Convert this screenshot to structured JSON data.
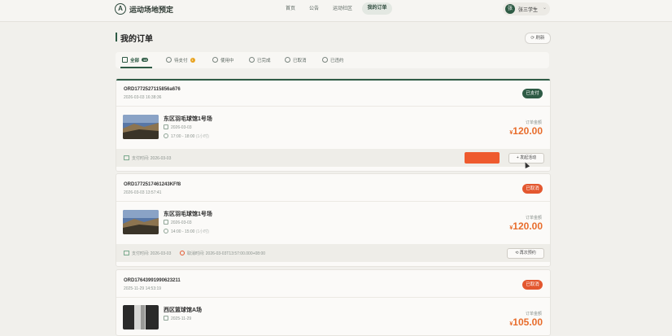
{
  "app": {
    "brand": "运动场地预定",
    "logo_letter": "A"
  },
  "nav": {
    "items": [
      "首页",
      "公告",
      "运动社区",
      "我的订单"
    ],
    "active": "我的订单"
  },
  "user": {
    "avatar_letter": "张",
    "name": "张三学生",
    "caret": "⌄"
  },
  "page": {
    "title": "我的订单",
    "refresh_label": "⟳ 刷新"
  },
  "tabs": [
    {
      "label": "全部",
      "badge": "13"
    },
    {
      "label": "待支付",
      "badge": "1"
    },
    {
      "label": "使用中"
    },
    {
      "label": "已完成"
    },
    {
      "label": "已取消"
    },
    {
      "label": "已违约"
    }
  ],
  "orders": [
    {
      "order_no": "ORD1772527115856a676",
      "created": "2026-03-03 16:38:36",
      "status": "已支付",
      "venue": "东区羽毛球馆1号场",
      "date": "2026-03-03",
      "time": "17:00 - 18:00",
      "duration": "(1小时)",
      "amount_label": "订单金额",
      "currency": "¥",
      "amount": "120.00",
      "pay_time": "支付时间: 2026-03-03",
      "action_label": "+ 发起活动"
    },
    {
      "order_no": "ORD1772517461243KFf8",
      "created": "2026-03-03 13:57:41",
      "status": "已取消",
      "venue": "东区羽毛球馆1号场",
      "date": "2026-03-03",
      "time": "14:00 - 15:00",
      "duration": "(1小时)",
      "amount_label": "订单金额",
      "currency": "¥",
      "amount": "120.00",
      "pay_time": "支付时间: 2026-03-03",
      "cancel_time": "取消时间: 2026-03-03T13:57:00.000+08:00",
      "action_label": "⟲ 再次预约"
    },
    {
      "order_no": "ORD17643991990623211",
      "created": "2025-11-29 14:53:19",
      "status": "已取消",
      "venue": "西区篮球馆A场",
      "date": "2025-11-29",
      "amount_label": "订单金额",
      "currency": "¥",
      "amount": "105.00"
    }
  ]
}
